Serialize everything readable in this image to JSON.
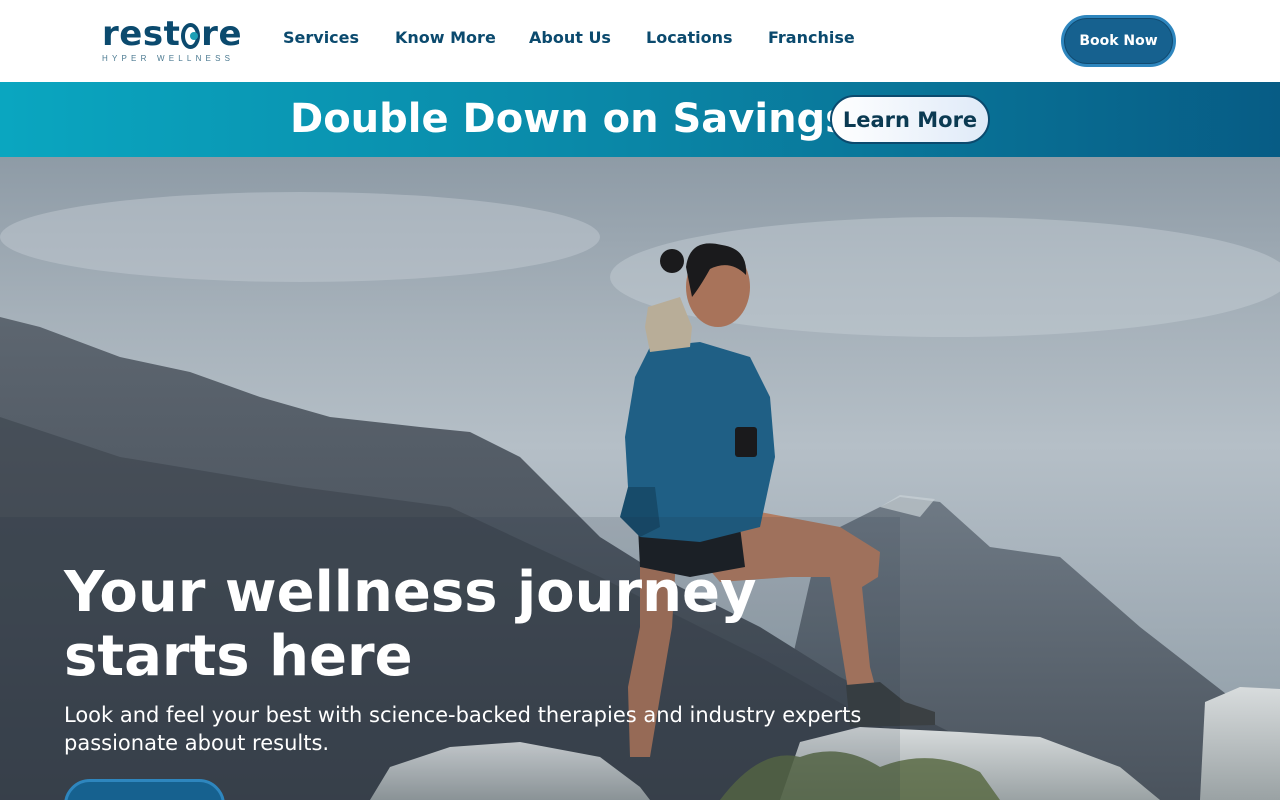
{
  "brand": {
    "name": "restore",
    "tagline": "HYPER WELLNESS",
    "primary_color": "#0b4a6e",
    "accent_color": "#1b9fb6"
  },
  "nav": {
    "items": [
      {
        "label": "Services"
      },
      {
        "label": "Know More"
      },
      {
        "label": "About Us"
      },
      {
        "label": "Locations"
      },
      {
        "label": "Franchise"
      }
    ],
    "book_label": "Book Now"
  },
  "promo": {
    "text": "Double Down on Savings",
    "button_label": "Learn More"
  },
  "hero": {
    "title": "Your wellness journey starts here",
    "subtitle": "Look and feel your best with science-backed therapies and industry experts passionate about results.",
    "image_icon": "hiker-on-mountain-image"
  }
}
